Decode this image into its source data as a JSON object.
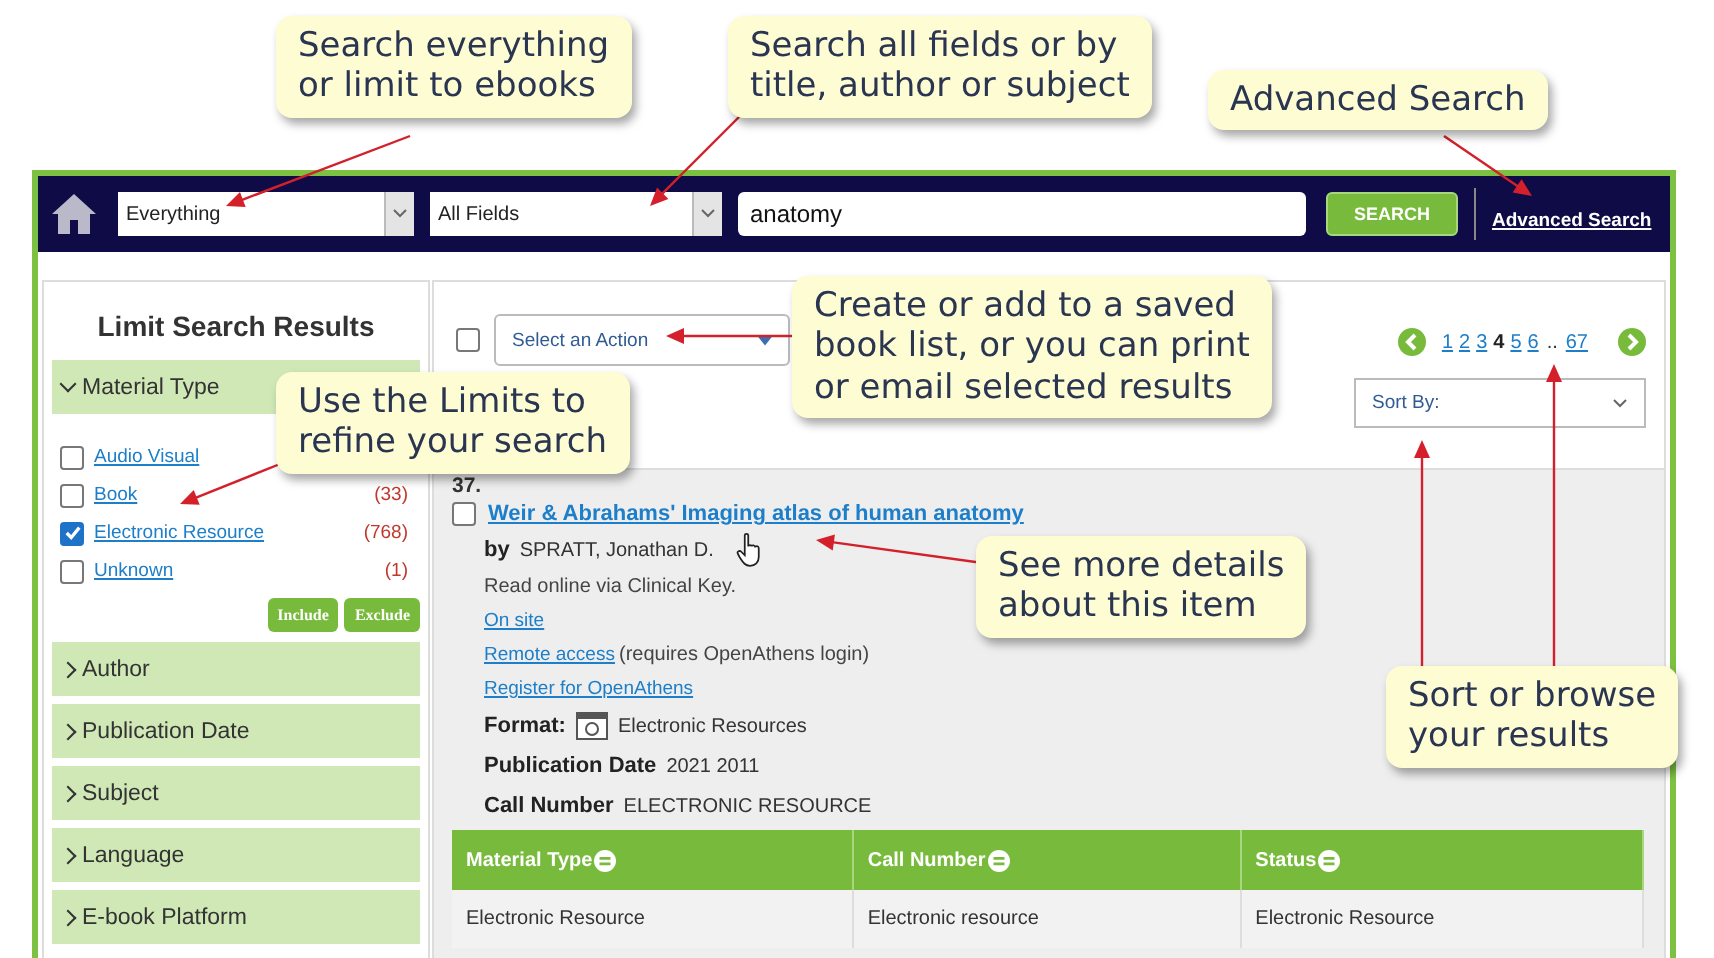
{
  "callouts": [
    {
      "lines": [
        "Search everything",
        "or limit to ebooks"
      ]
    },
    {
      "lines": [
        "Search all fields or by",
        "title, author or subject"
      ]
    },
    {
      "lines": [
        "Advanced Search"
      ]
    },
    {
      "lines": [
        "Create or add to a saved",
        "book list, or you can print",
        "or email selected results"
      ]
    },
    {
      "lines": [
        "Use the Limits to",
        "refine your search"
      ]
    },
    {
      "lines": [
        "See more details",
        "about this item"
      ]
    },
    {
      "lines": [
        "Sort or browse",
        "your results"
      ]
    }
  ],
  "search_bar": {
    "scope": "Everything",
    "field": "All Fields",
    "query": "anatomy",
    "button": "SEARCH",
    "advanced_link": "Advanced Search"
  },
  "sidebar": {
    "title": "Limit Search Results",
    "sections": [
      {
        "label": "Material Type",
        "expanded": true,
        "options": [
          {
            "label": "Audio Visual",
            "checked": false
          },
          {
            "label": "Book",
            "count": "(33)",
            "checked": false
          },
          {
            "label": "Electronic Resource",
            "count": "(768)",
            "checked": true
          },
          {
            "label": "Unknown",
            "count": "(1)",
            "checked": false
          }
        ],
        "buttons": [
          "Include",
          "Exclude"
        ]
      },
      {
        "label": "Author",
        "expanded": false
      },
      {
        "label": "Publication Date",
        "expanded": false
      },
      {
        "label": "Subject",
        "expanded": false
      },
      {
        "label": "Language",
        "expanded": false
      },
      {
        "label": "E-book Platform",
        "expanded": false
      }
    ]
  },
  "toolbar": {
    "select_all_checked": false,
    "action_placeholder": "Select an Action",
    "pages": [
      {
        "label": "1",
        "selected": false
      },
      {
        "label": "2",
        "selected": false
      },
      {
        "label": "3",
        "selected": false
      },
      {
        "label": "4",
        "selected": true
      },
      {
        "label": "5",
        "selected": false
      },
      {
        "label": "6",
        "selected": false
      }
    ],
    "gap": "..",
    "last_page": {
      "label": "67",
      "selected": false
    },
    "sort_placeholder": "Sort By:"
  },
  "result": {
    "number": "37.",
    "checked": false,
    "title": "Weir & Abrahams' Imaging atlas of human anatomy",
    "by_label": "by",
    "author": "SPRATT, Jonathan D.",
    "note": "Read online via Clinical Key.",
    "links": [
      {
        "text": "On site"
      },
      {
        "text": "Remote access",
        "suffix": "(requires OpenAthens login)"
      },
      {
        "text": "Register for OpenAthens"
      }
    ],
    "fields": [
      {
        "kind": "format",
        "label": "Format:",
        "value": "Electronic Resources"
      },
      {
        "kind": "text",
        "label": "Publication Date",
        "value": "2021 2011"
      },
      {
        "kind": "text",
        "label": "Call Number",
        "value": "ELECTRONIC RESOURCE"
      }
    ],
    "table": {
      "columns": [
        "Material Type",
        "Call Number",
        "Status"
      ],
      "rows": [
        [
          "Electronic Resource",
          "Electronic resource",
          "Electronic Resource"
        ]
      ]
    }
  }
}
